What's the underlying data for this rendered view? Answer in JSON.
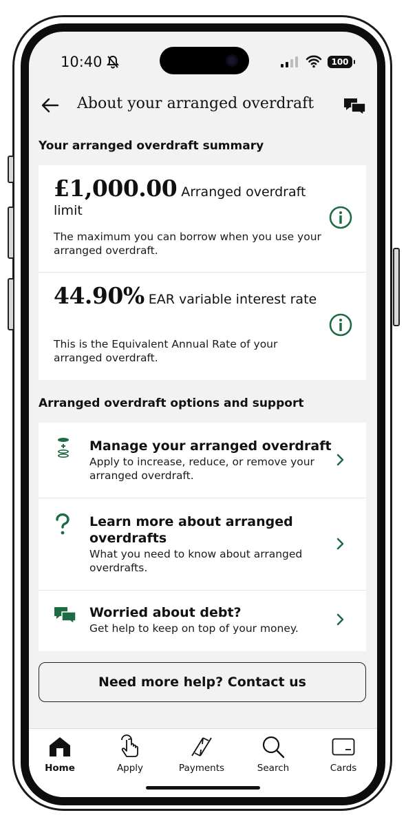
{
  "status_bar": {
    "time": "10:40",
    "battery": "100"
  },
  "header": {
    "title": "About your arranged overdraft"
  },
  "summary": {
    "section_title": "Your arranged overdraft summary",
    "items": [
      {
        "value": "£1,000.00",
        "label": "Arranged overdraft limit",
        "description": "The maximum you can borrow when you use your arranged overdraft."
      },
      {
        "value": "44.90%",
        "label": "EAR variable interest rate",
        "description": "This is the Equivalent Annual Rate of your arranged overdraft."
      }
    ]
  },
  "options": {
    "section_title": "Arranged overdraft options and support",
    "items": [
      {
        "title": "Manage your arranged overdraft",
        "description": "Apply to increase, reduce, or remove your arranged overdraft.",
        "icon": "coins-stack-icon"
      },
      {
        "title": "Learn more about arranged overdrafts",
        "description": "What you need to know about arranged overdrafts.",
        "icon": "question-mark-icon"
      },
      {
        "title": "Worried about debt?",
        "description": "Get help to keep on top of your money.",
        "icon": "chat-bubbles-icon"
      }
    ]
  },
  "contact_button": {
    "label": "Need more help? Contact us"
  },
  "tab_bar": {
    "tabs": [
      {
        "label": "Home",
        "icon": "home-icon",
        "active": true
      },
      {
        "label": "Apply",
        "icon": "tap-finger-icon",
        "active": false
      },
      {
        "label": "Payments",
        "icon": "payments-arrows-icon",
        "active": false
      },
      {
        "label": "Search",
        "icon": "search-icon",
        "active": false
      },
      {
        "label": "Cards",
        "icon": "card-icon",
        "active": false
      }
    ]
  },
  "colors": {
    "accent_green": "#1d6b45",
    "background": "#f2f2f2",
    "card": "#ffffff"
  }
}
